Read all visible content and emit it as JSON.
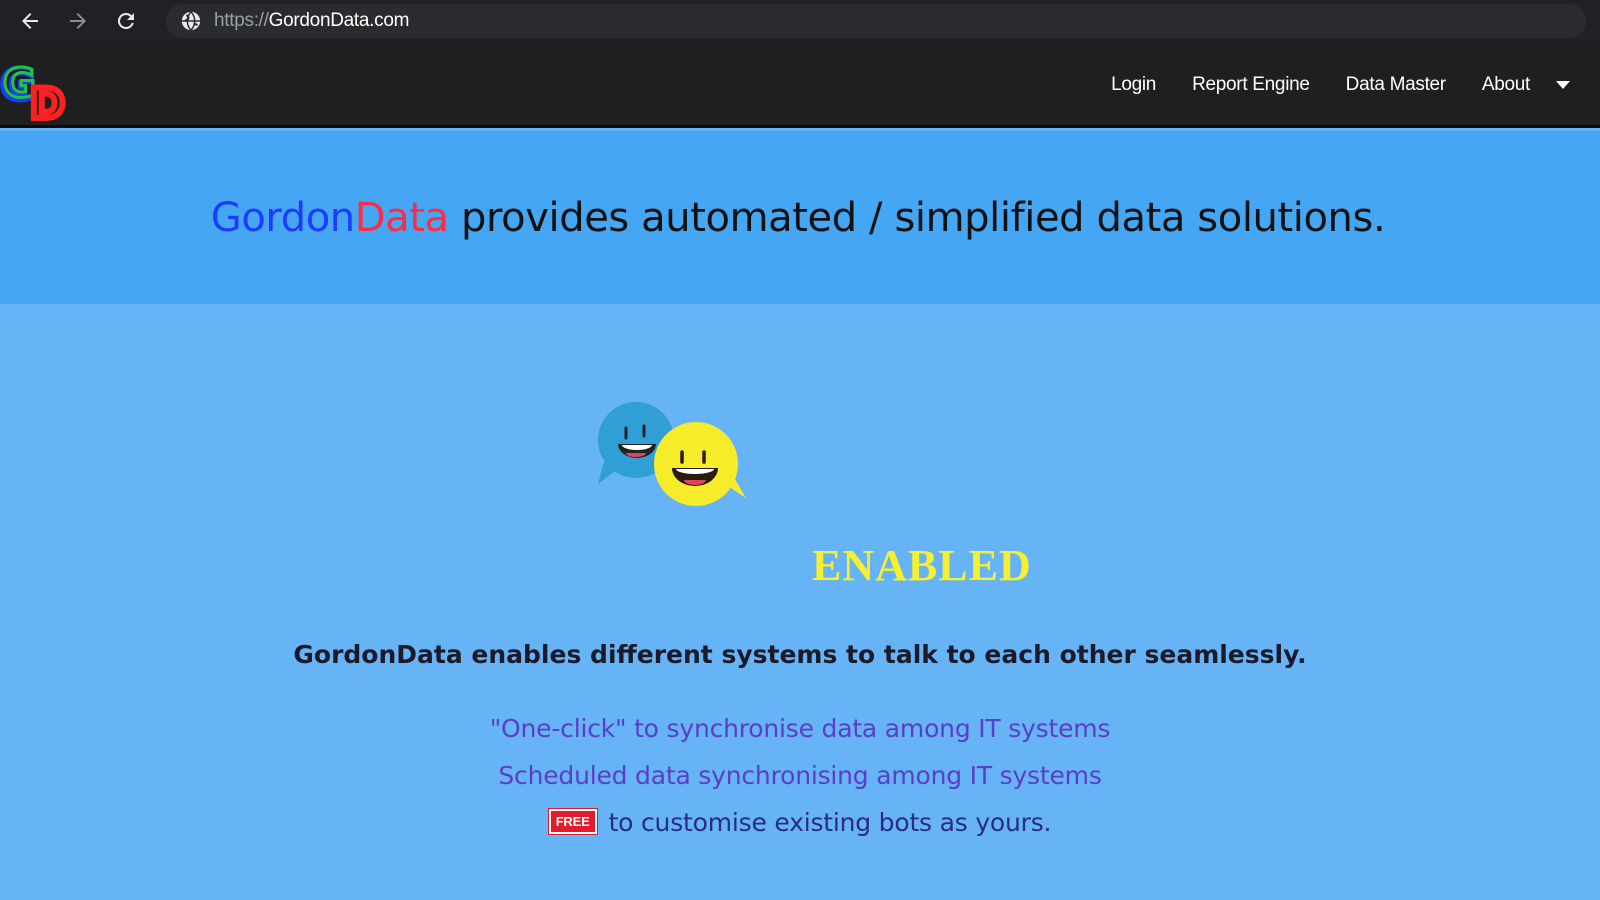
{
  "browser": {
    "url_scheme": "https://",
    "url_host": "GordonData.com"
  },
  "nav": {
    "logo_letters": "GD",
    "links": [
      "Login",
      "Report Engine",
      "Data Master",
      "About"
    ]
  },
  "hero": {
    "brand_part1": "Gordon",
    "brand_part2": "Data",
    "headline_rest": " provides automated / simplified data solutions."
  },
  "main": {
    "enabled_label": "ENABLED",
    "tagline": "GordonData enables different systems to talk to each other seamlessly.",
    "features": [
      "\"One-click\" to synchronise data among IT systems",
      "Scheduled data synchronising among IT systems",
      "to customise existing bots as yours."
    ],
    "free_badge": "FREE"
  },
  "colors": {
    "hero_bg": "#45a6f4",
    "main_bg": "#66b3f5",
    "brand_blue": "#1e3cff",
    "brand_red": "#ff2a45",
    "enabled_yellow": "#f6f030",
    "feature_purple": "#5a3ec8"
  },
  "icons": [
    "back-arrow-icon",
    "forward-arrow-icon",
    "reload-icon",
    "globe-icon",
    "chevron-down-icon",
    "chat-bubbles-icon"
  ]
}
